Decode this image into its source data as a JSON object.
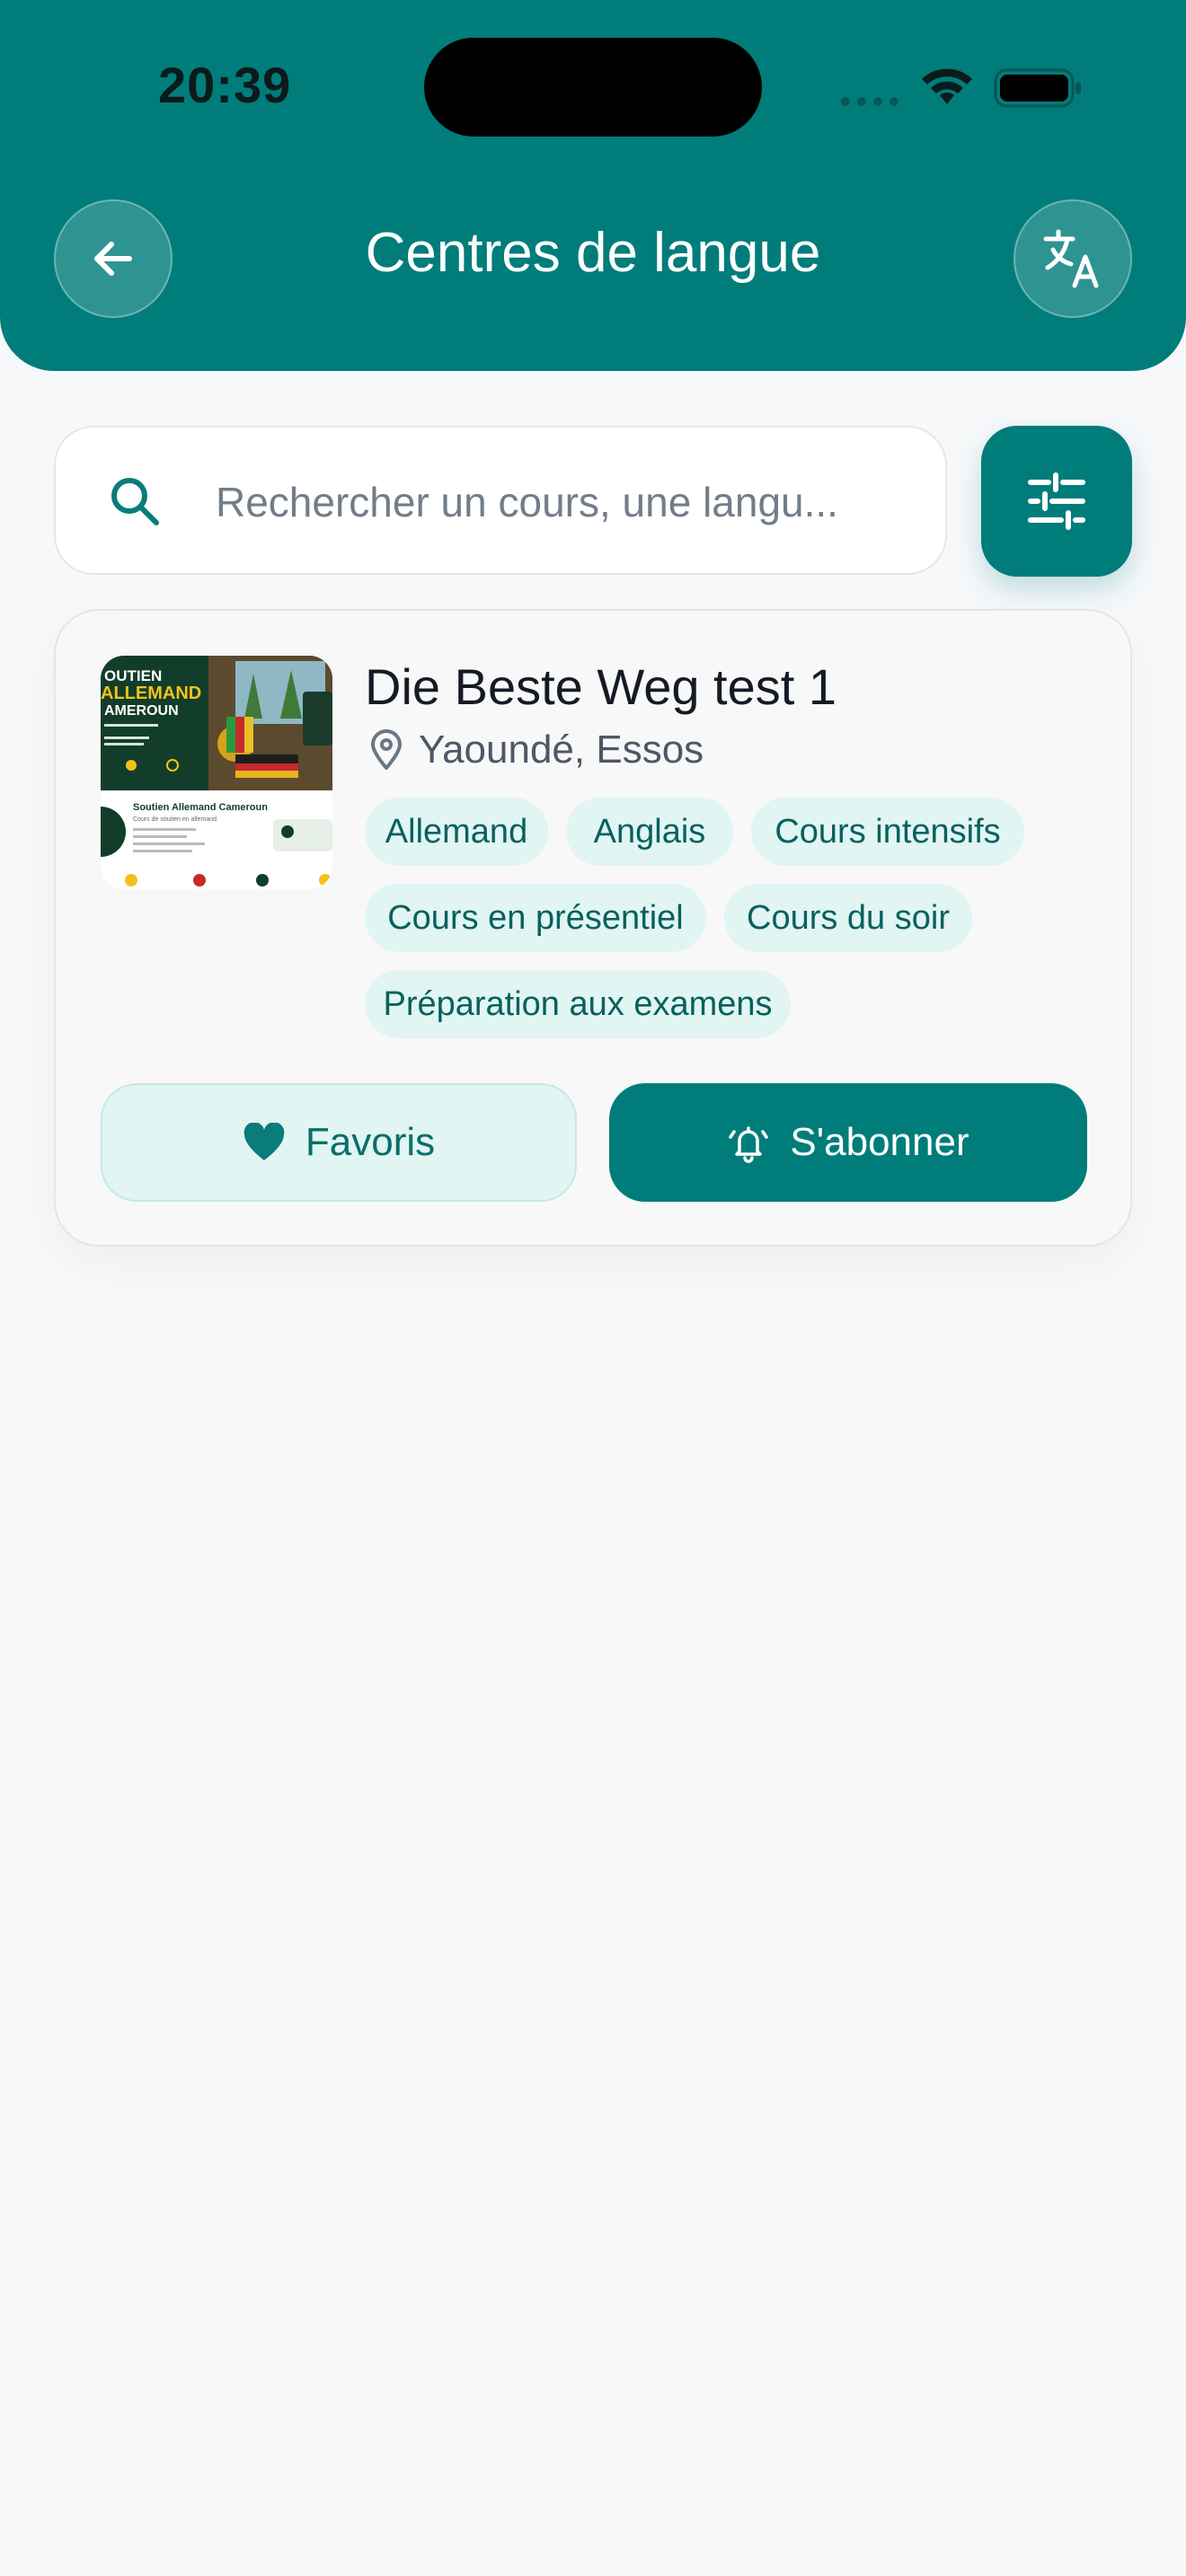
{
  "status_bar": {
    "time": "20:39"
  },
  "header": {
    "title": "Centres de langue",
    "back_icon": "arrow-left-icon",
    "translate_icon": "translate-icon"
  },
  "search": {
    "placeholder": "Rechercher un cours, une langu...",
    "value": ""
  },
  "colors": {
    "primary": "#007d7a",
    "tag_bg": "#e1f5f3",
    "tag_text": "#07615d",
    "page_bg": "#f6f8fa"
  },
  "card": {
    "title": "Die Beste Weg test 1",
    "location": "Yaoundé, Essos",
    "tags": [
      "Allemand",
      "Anglais",
      "Cours intensifs",
      "Cours en présentiel",
      "Cours du soir",
      "Préparation aux examens"
    ],
    "favorite_label": "Favoris",
    "subscribe_label": "S'abonner",
    "thumbnail": {
      "headline_1": "OUTIEN",
      "headline_2": "ALLEMAND",
      "headline_3": "AMEROUN",
      "brand": "Soutien Allemand Cameroun",
      "tagline": "Cours de soutien en allemand"
    }
  }
}
